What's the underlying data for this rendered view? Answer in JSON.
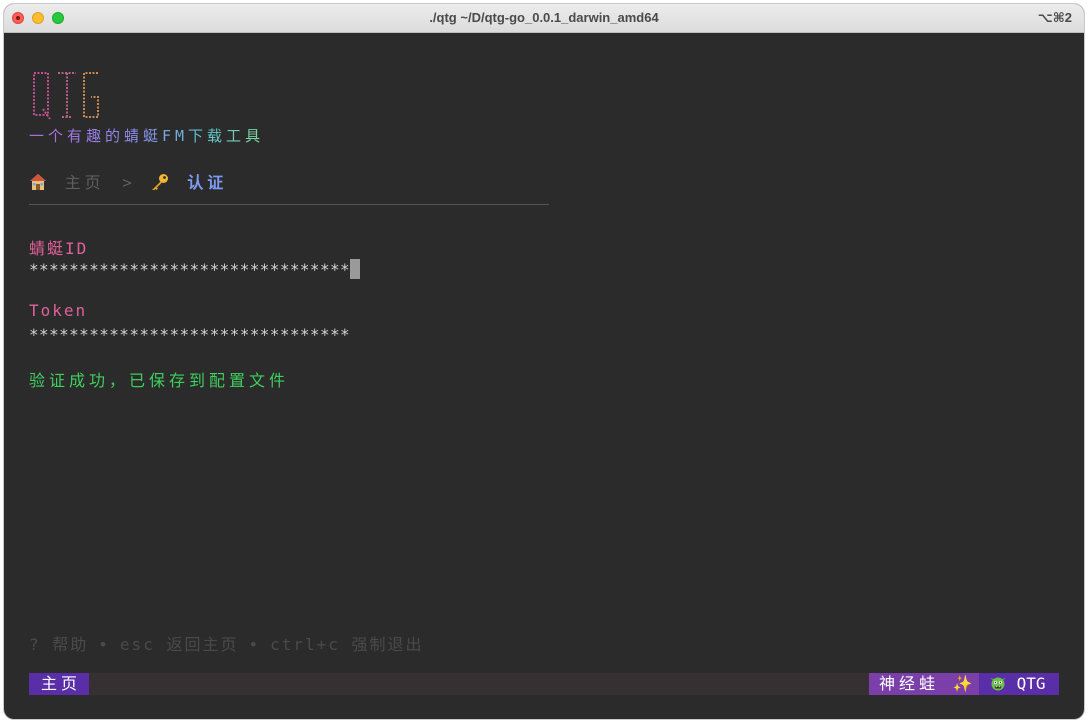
{
  "window": {
    "title": "./qtg  ~/D/qtg-go_0.0.1_darwin_amd64",
    "shortcut": "⌥⌘2"
  },
  "logo": {
    "text": "QTG",
    "colors": [
      "#c14e8e",
      "#c15a6e",
      "#c98a52"
    ]
  },
  "subtitle": "一个有趣的蜻蜓FM下载工具",
  "breadcrumb": {
    "home_icon": "house-icon",
    "home_label": "主页",
    "separator": ">",
    "current_icon": "key-icon",
    "current_label": "认证"
  },
  "form": {
    "id_label": "蜻蜓ID",
    "id_value": "********************************",
    "token_label": "Token",
    "token_value": "********************************"
  },
  "status_message": "验证成功，已保存到配置文件",
  "help_bar": {
    "help": "? 帮助",
    "separator": "•",
    "esc": "esc 返回主页",
    "quit": "ctrl+c 强制退出"
  },
  "statusbar": {
    "left": "主页",
    "right_label": "神经蛙",
    "right_sparkle": "✨",
    "app_icon": "goblin-icon",
    "app_name": "QTG"
  },
  "colors": {
    "background": "#2b2b2b",
    "accent_pink": "#e0609a",
    "accent_blue": "#7f9cf5",
    "success_green": "#3ecf5d",
    "status_purple": "#5a2ea6"
  }
}
